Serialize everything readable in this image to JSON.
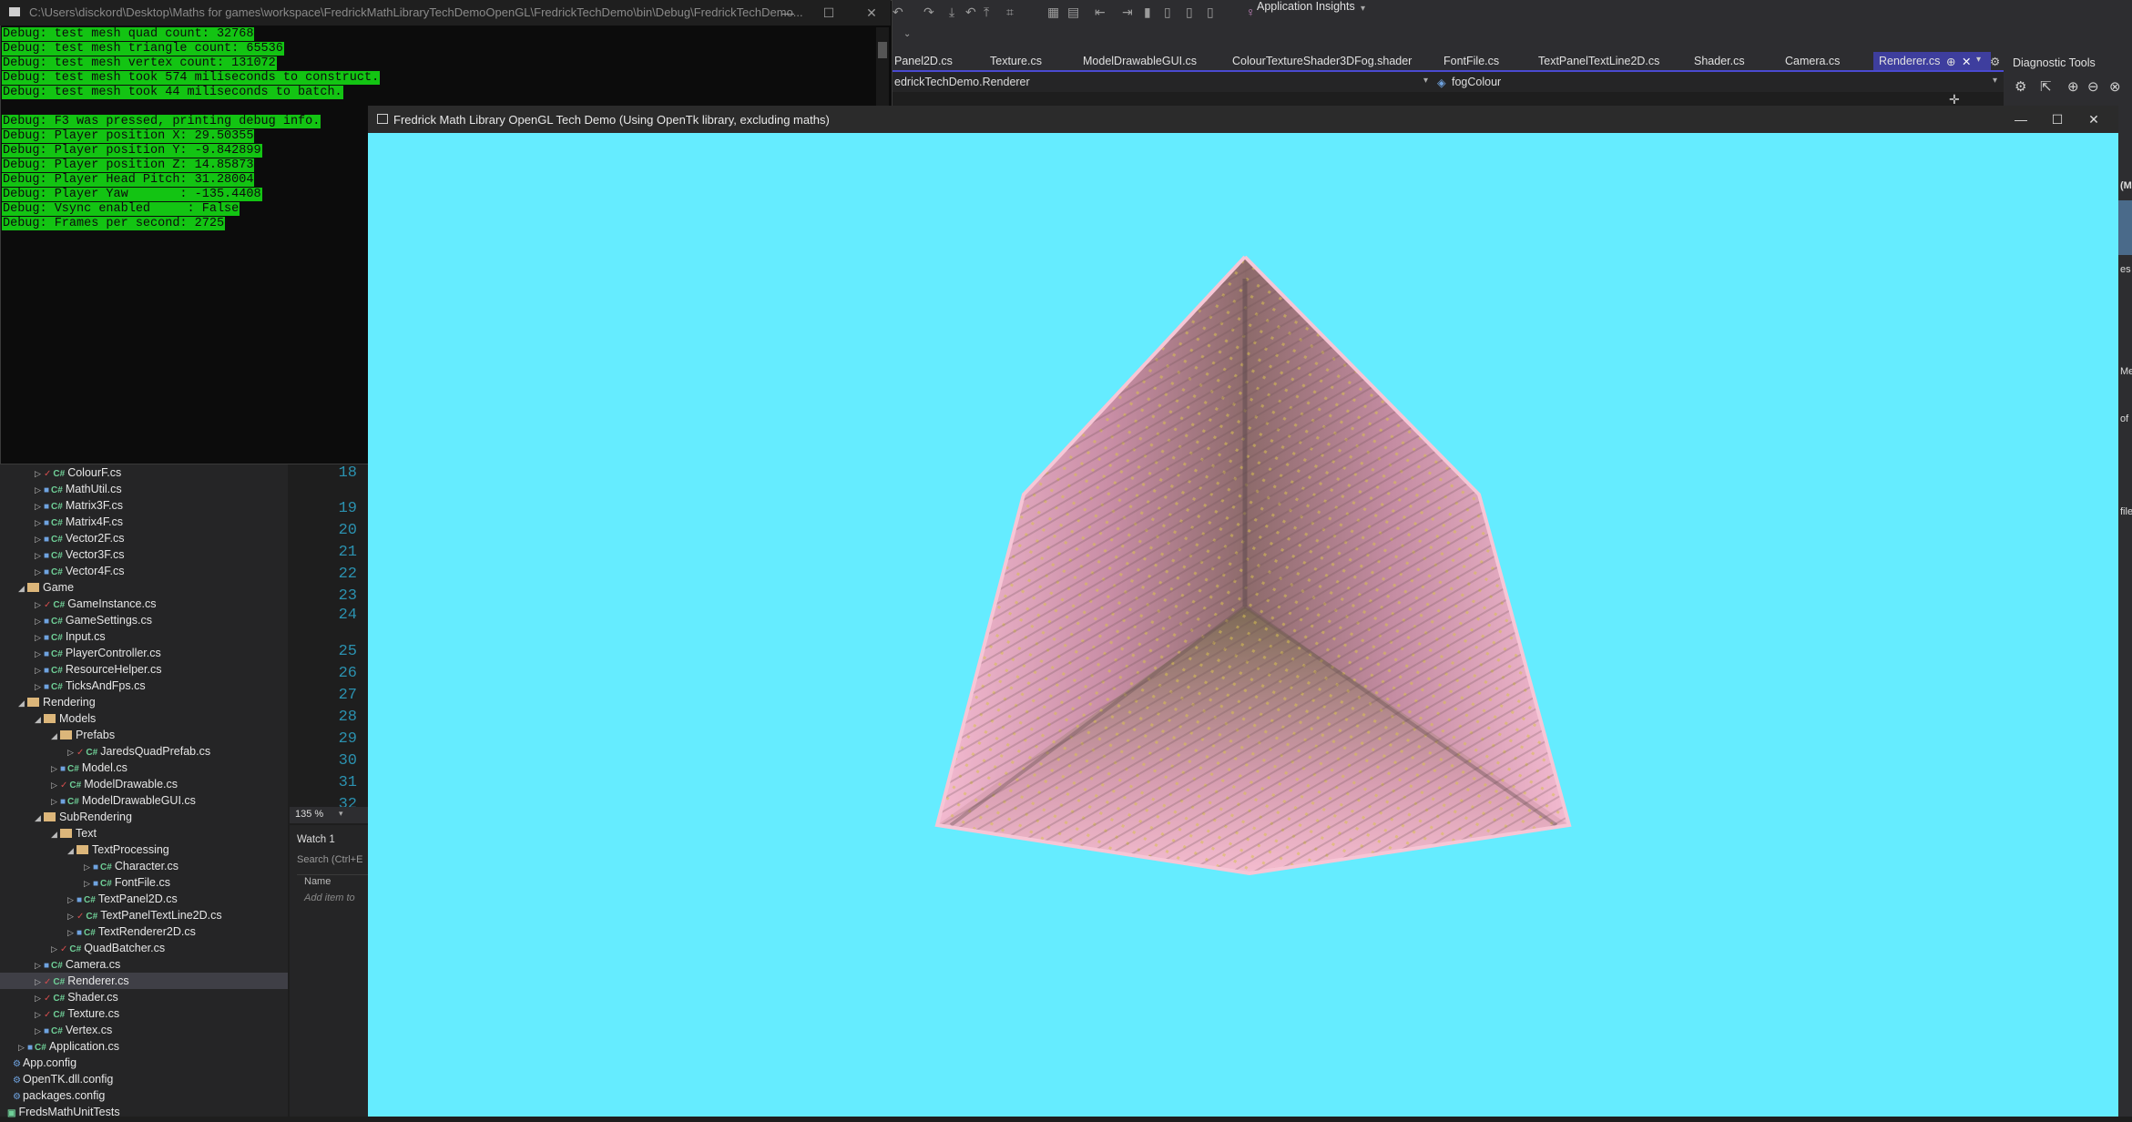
{
  "console": {
    "title": "C:\\Users\\disckord\\Desktop\\Maths for games\\workspace\\FredrickMathLibraryTechDemoOpenGL\\FredrickTechDemo\\bin\\Debug\\FredrickTechDemo...",
    "lines": [
      "Debug: test mesh quad count: 32768",
      "Debug: test mesh triangle count: 65536",
      "Debug: test mesh vertex count: 131072",
      "Debug: test mesh took 574 miliseconds to construct.",
      "Debug: test mesh took 44 miliseconds to batch.",
      "",
      "Debug: F3 was pressed, printing debug info.",
      "Debug: Player position X: 29.50355",
      "Debug: Player position Y: -9.842899",
      "Debug: Player position Z: 14.85873",
      "Debug: Player Head Pitch: 31.28004",
      "Debug: Player Yaw       : -135.4408",
      "Debug: Vsync enabled     : False",
      "Debug: Frames per second: 2725"
    ]
  },
  "vs": {
    "toolbar_extension": "Application Insights",
    "tabs": [
      "Panel2D.cs",
      "Texture.cs",
      "ModelDrawableGUI.cs",
      "ColourTextureShader3DFog.shader",
      "FontFile.cs",
      "TextPanelTextLine2D.cs",
      "Shader.cs",
      "Camera.cs",
      "Renderer.cs"
    ],
    "nav_class": "edrickTechDemo.Renderer",
    "nav_member": "fogColour",
    "diagnostic_title": "Diagnostic Tools"
  },
  "solution": {
    "items": [
      {
        "label": "ColourF.cs"
      },
      {
        "label": "MathUtil.cs"
      },
      {
        "label": "Matrix3F.cs"
      },
      {
        "label": "Matrix4F.cs"
      },
      {
        "label": "Vector2F.cs"
      },
      {
        "label": "Vector3F.cs"
      },
      {
        "label": "Vector4F.cs"
      },
      {
        "label": "Game"
      },
      {
        "label": "GameInstance.cs"
      },
      {
        "label": "GameSettings.cs"
      },
      {
        "label": "Input.cs"
      },
      {
        "label": "PlayerController.cs"
      },
      {
        "label": "ResourceHelper.cs"
      },
      {
        "label": "TicksAndFps.cs"
      },
      {
        "label": "Rendering"
      },
      {
        "label": "Models"
      },
      {
        "label": "Prefabs"
      },
      {
        "label": "JaredsQuadPrefab.cs"
      },
      {
        "label": "Model.cs"
      },
      {
        "label": "ModelDrawable.cs"
      },
      {
        "label": "ModelDrawableGUI.cs"
      },
      {
        "label": "SubRendering"
      },
      {
        "label": "Text"
      },
      {
        "label": "TextProcessing"
      },
      {
        "label": "Character.cs"
      },
      {
        "label": "FontFile.cs"
      },
      {
        "label": "TextPanel2D.cs"
      },
      {
        "label": "TextPanelTextLine2D.cs"
      },
      {
        "label": "TextRenderer2D.cs"
      },
      {
        "label": "QuadBatcher.cs"
      },
      {
        "label": "Camera.cs"
      },
      {
        "label": "Renderer.cs"
      },
      {
        "label": "Shader.cs"
      },
      {
        "label": "Texture.cs"
      },
      {
        "label": "Vertex.cs"
      },
      {
        "label": "Application.cs"
      },
      {
        "label": "App.config"
      },
      {
        "label": "OpenTK.dll.config"
      },
      {
        "label": "packages.config"
      },
      {
        "label": "FredsMathUnitTests"
      }
    ]
  },
  "editor": {
    "line_numbers": [
      "18",
      "19",
      "20",
      "21",
      "22",
      "23",
      "24",
      "25",
      "26",
      "27",
      "28",
      "29",
      "30",
      "31",
      "32"
    ],
    "zoom": "135 %",
    "watch_title": "Watch 1",
    "watch_search": "Search (Ctrl+E",
    "watch_col": "Name",
    "watch_add": "Add item to"
  },
  "game": {
    "title": "Fredrick Math Library OpenGL Tech Demo (Using OpenTk library, excluding maths)",
    "sky_color": "#65ecff",
    "cube_color": "#f2b8cc"
  },
  "diag_fragments": [
    "(M",
    "es",
    "Me",
    "of",
    "file"
  ]
}
